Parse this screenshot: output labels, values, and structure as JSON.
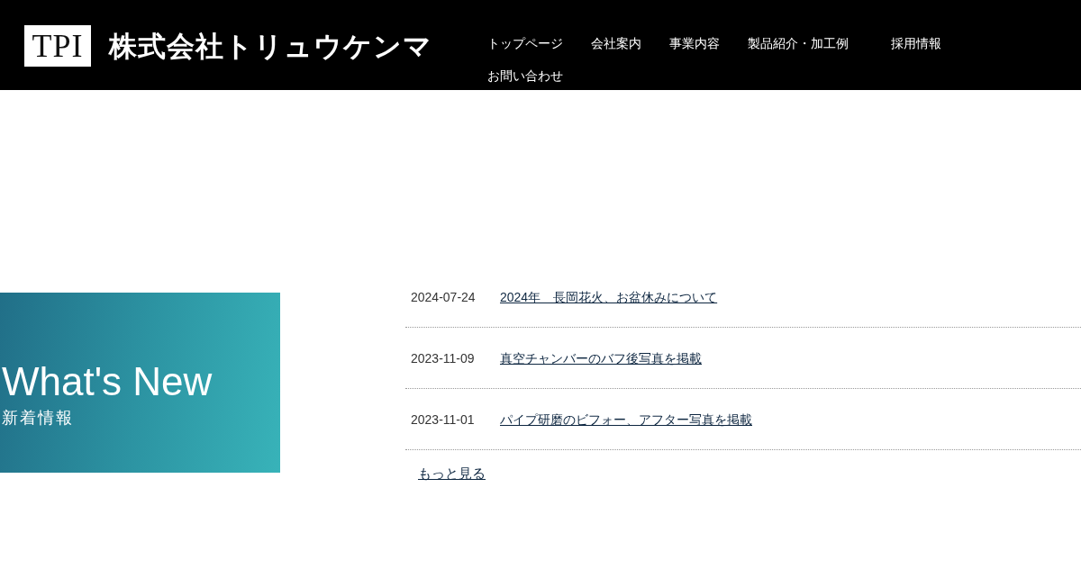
{
  "header": {
    "logo": {
      "mark": "TPI",
      "name": "株式会社トリュウケンマ"
    },
    "nav": [
      {
        "label": "トップページ"
      },
      {
        "label": "会社案内"
      },
      {
        "label": "事業内容"
      },
      {
        "label": "製品紹介・加工例"
      },
      {
        "label": "採用情報"
      },
      {
        "label": "お問い合わせ"
      }
    ]
  },
  "news_heading": {
    "title": "What's New",
    "subtitle": "新着情報"
  },
  "news": [
    {
      "date": "2024-07-24",
      "title": "2024年　長岡花火、お盆休みについて"
    },
    {
      "date": "2023-11-09",
      "title": "真空チャンバーのバフ後写真を掲載"
    },
    {
      "date": "2023-11-01",
      "title": "パイプ研磨のビフォー、アフター写真を掲載"
    }
  ],
  "more_link": "もっと見る"
}
